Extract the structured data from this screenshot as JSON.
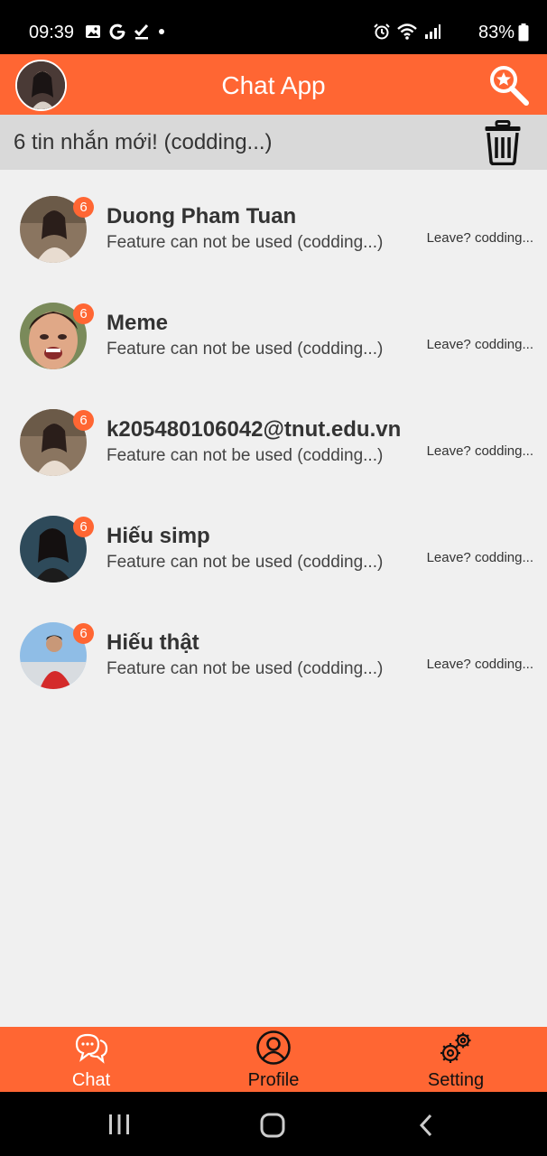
{
  "status_bar": {
    "time": "09:39",
    "battery": "83%"
  },
  "header": {
    "title": "Chat App"
  },
  "banner": {
    "text": "6 tin nhắn mới! (codding...)"
  },
  "chats": [
    {
      "name": "Duong Pham Tuan",
      "message": "Feature can not be used (codding...)",
      "time": "Leave? codding...",
      "badge": "6"
    },
    {
      "name": "Meme",
      "message": "Feature can not be used (codding...)",
      "time": "Leave? codding...",
      "badge": "6"
    },
    {
      "name": "k205480106042@tnut.edu.vn",
      "message": "Feature can not be used (codding...)",
      "time": "Leave? codding...",
      "badge": "6"
    },
    {
      "name": "Hiếu simp",
      "message": "Feature can not be used (codding...)",
      "time": "Leave? codding...",
      "badge": "6"
    },
    {
      "name": "Hiếu thật",
      "message": "Feature can not be used (codding...)",
      "time": "Leave? codding...",
      "badge": "6"
    }
  ],
  "nav": {
    "chat": "Chat",
    "profile": "Profile",
    "setting": "Setting"
  },
  "colors": {
    "accent": "#ff6633",
    "banner": "#d9d9d9",
    "background": "#f0f0f0"
  }
}
